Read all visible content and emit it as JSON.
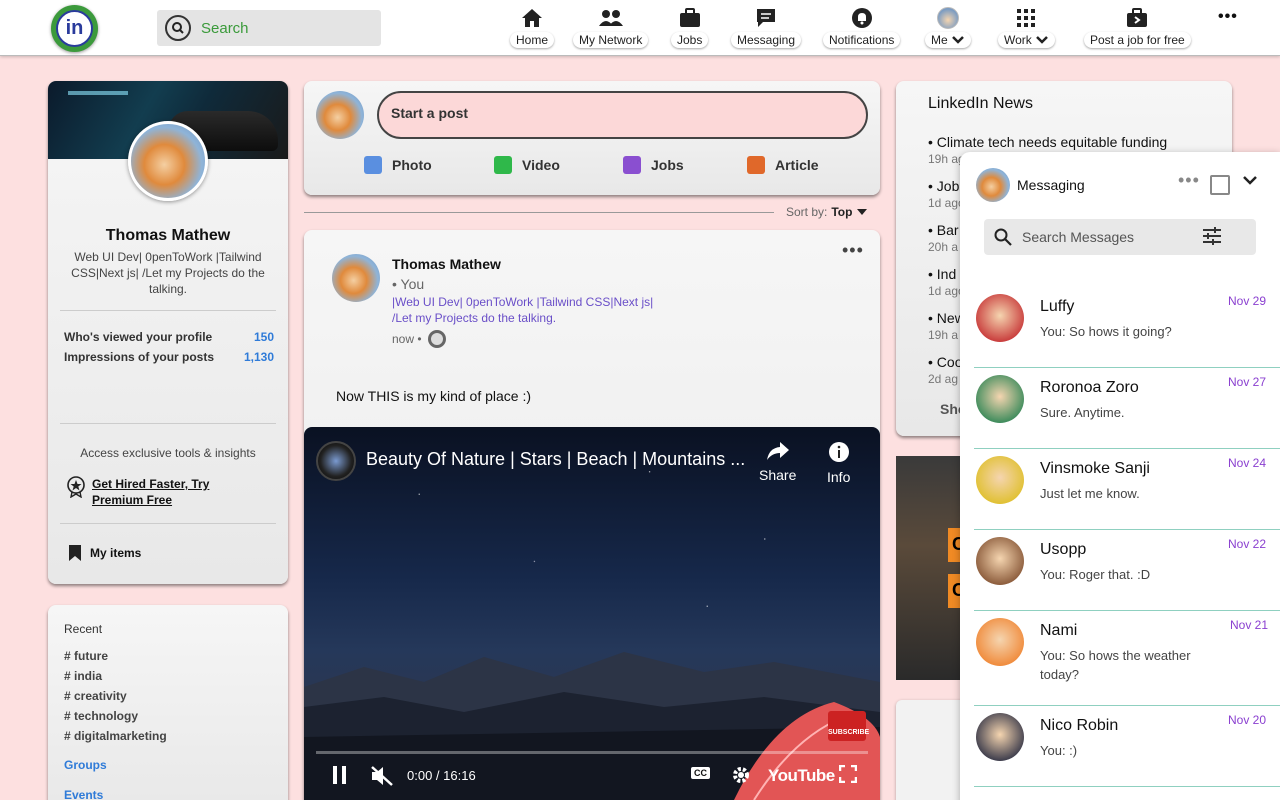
{
  "header": {
    "logo_text": "in",
    "search_placeholder": "Search",
    "nav": [
      {
        "label": "Home",
        "icon": "home-icon"
      },
      {
        "label": "My Network",
        "icon": "people-icon"
      },
      {
        "label": "Jobs",
        "icon": "briefcase-icon"
      },
      {
        "label": "Messaging",
        "icon": "chat-icon"
      },
      {
        "label": "Notifications",
        "icon": "bell-icon"
      },
      {
        "label": "Me",
        "icon": "avatar"
      },
      {
        "label": "Work",
        "icon": "grid-icon"
      },
      {
        "label": "Post a job for free",
        "icon": "briefcase-arrow-icon"
      }
    ],
    "more": "•••"
  },
  "profile": {
    "name": "Thomas Mathew",
    "headline": "Web UI Dev| 0penToWork |Tailwind CSS|Next js| /Let my Projects do the talking.",
    "stats": [
      {
        "label": "Who's viewed your profile",
        "value": "150"
      },
      {
        "label": "Impressions of your posts",
        "value": "1,130"
      }
    ],
    "premium_text": "Access exclusive tools & insights",
    "premium_link": "Get Hired Faster, Try Premium Free",
    "my_items": "My items"
  },
  "recent": {
    "title": "Recent",
    "tags": [
      "# future",
      "# india",
      "# creativity",
      "# technology",
      "# digitalmarketing"
    ],
    "groups": "Groups",
    "events": "Events"
  },
  "post_box": {
    "placeholder": "Start a post",
    "actions": [
      {
        "label": "Photo",
        "icon": "photo-icon",
        "color": "#5a8fe0"
      },
      {
        "label": "Video",
        "icon": "video-icon",
        "color": "#2fb84a"
      },
      {
        "label": "Jobs",
        "icon": "jobs-icon",
        "color": "#8a4fd0"
      },
      {
        "label": "Article",
        "icon": "article-icon",
        "color": "#e0682a"
      }
    ]
  },
  "sort": {
    "label": "Sort by:",
    "value": "Top"
  },
  "feed_post": {
    "author": "Thomas Mathew",
    "you": "• You",
    "headline": "|Web UI Dev| 0penToWork |Tailwind CSS|Next js| /Let my Projects do the talking.",
    "time": "now •",
    "text": "Now THIS is my kind of place :)",
    "video": {
      "title": "Beauty Of Nature | Stars | Beach | Mountains ...",
      "share": "Share",
      "info": "Info",
      "time": "0:00 / 16:16",
      "brand": "YouTube",
      "subscribe": "SUBSCRIBE",
      "cc": "CC"
    }
  },
  "news": {
    "title": "LinkedIn News",
    "items": [
      {
        "title": "• Climate tech needs equitable funding",
        "ago": "19h ago"
      },
      {
        "title": "• Job",
        "ago": "1d ago"
      },
      {
        "title": "• Bar",
        "ago": "20h a"
      },
      {
        "title": "• Ind",
        "ago": "1d ago"
      },
      {
        "title": "• New",
        "ago": "19h a"
      },
      {
        "title": "• Coo",
        "ago": "2d ag"
      }
    ],
    "show_more": "Sho"
  },
  "ad": {
    "letters": [
      "C",
      "C"
    ]
  },
  "messaging": {
    "title": "Messaging",
    "search_placeholder": "Search Messages",
    "conversations": [
      {
        "name": "Luffy",
        "last": "You: So hows it going?",
        "date": "Nov 29",
        "color": "#c83a3a"
      },
      {
        "name": "Roronoa Zoro",
        "last": "Sure. Anytime.",
        "date": "Nov 27",
        "color": "#3a8a5a"
      },
      {
        "name": "Vinsmoke Sanji",
        "last": "Just let me know.",
        "date": "Nov 24",
        "color": "#e0c030"
      },
      {
        "name": "Usopp",
        "last": "You: Roger that. :D",
        "date": "Nov 22",
        "color": "#8a5a3a"
      },
      {
        "name": "Nami",
        "last": "You: So hows the weather today?",
        "date": "Nov 21",
        "color": "#f08a3a"
      },
      {
        "name": "Nico Robin",
        "last": "You: :)",
        "date": "Nov 20",
        "color": "#3a3a4a"
      }
    ]
  }
}
